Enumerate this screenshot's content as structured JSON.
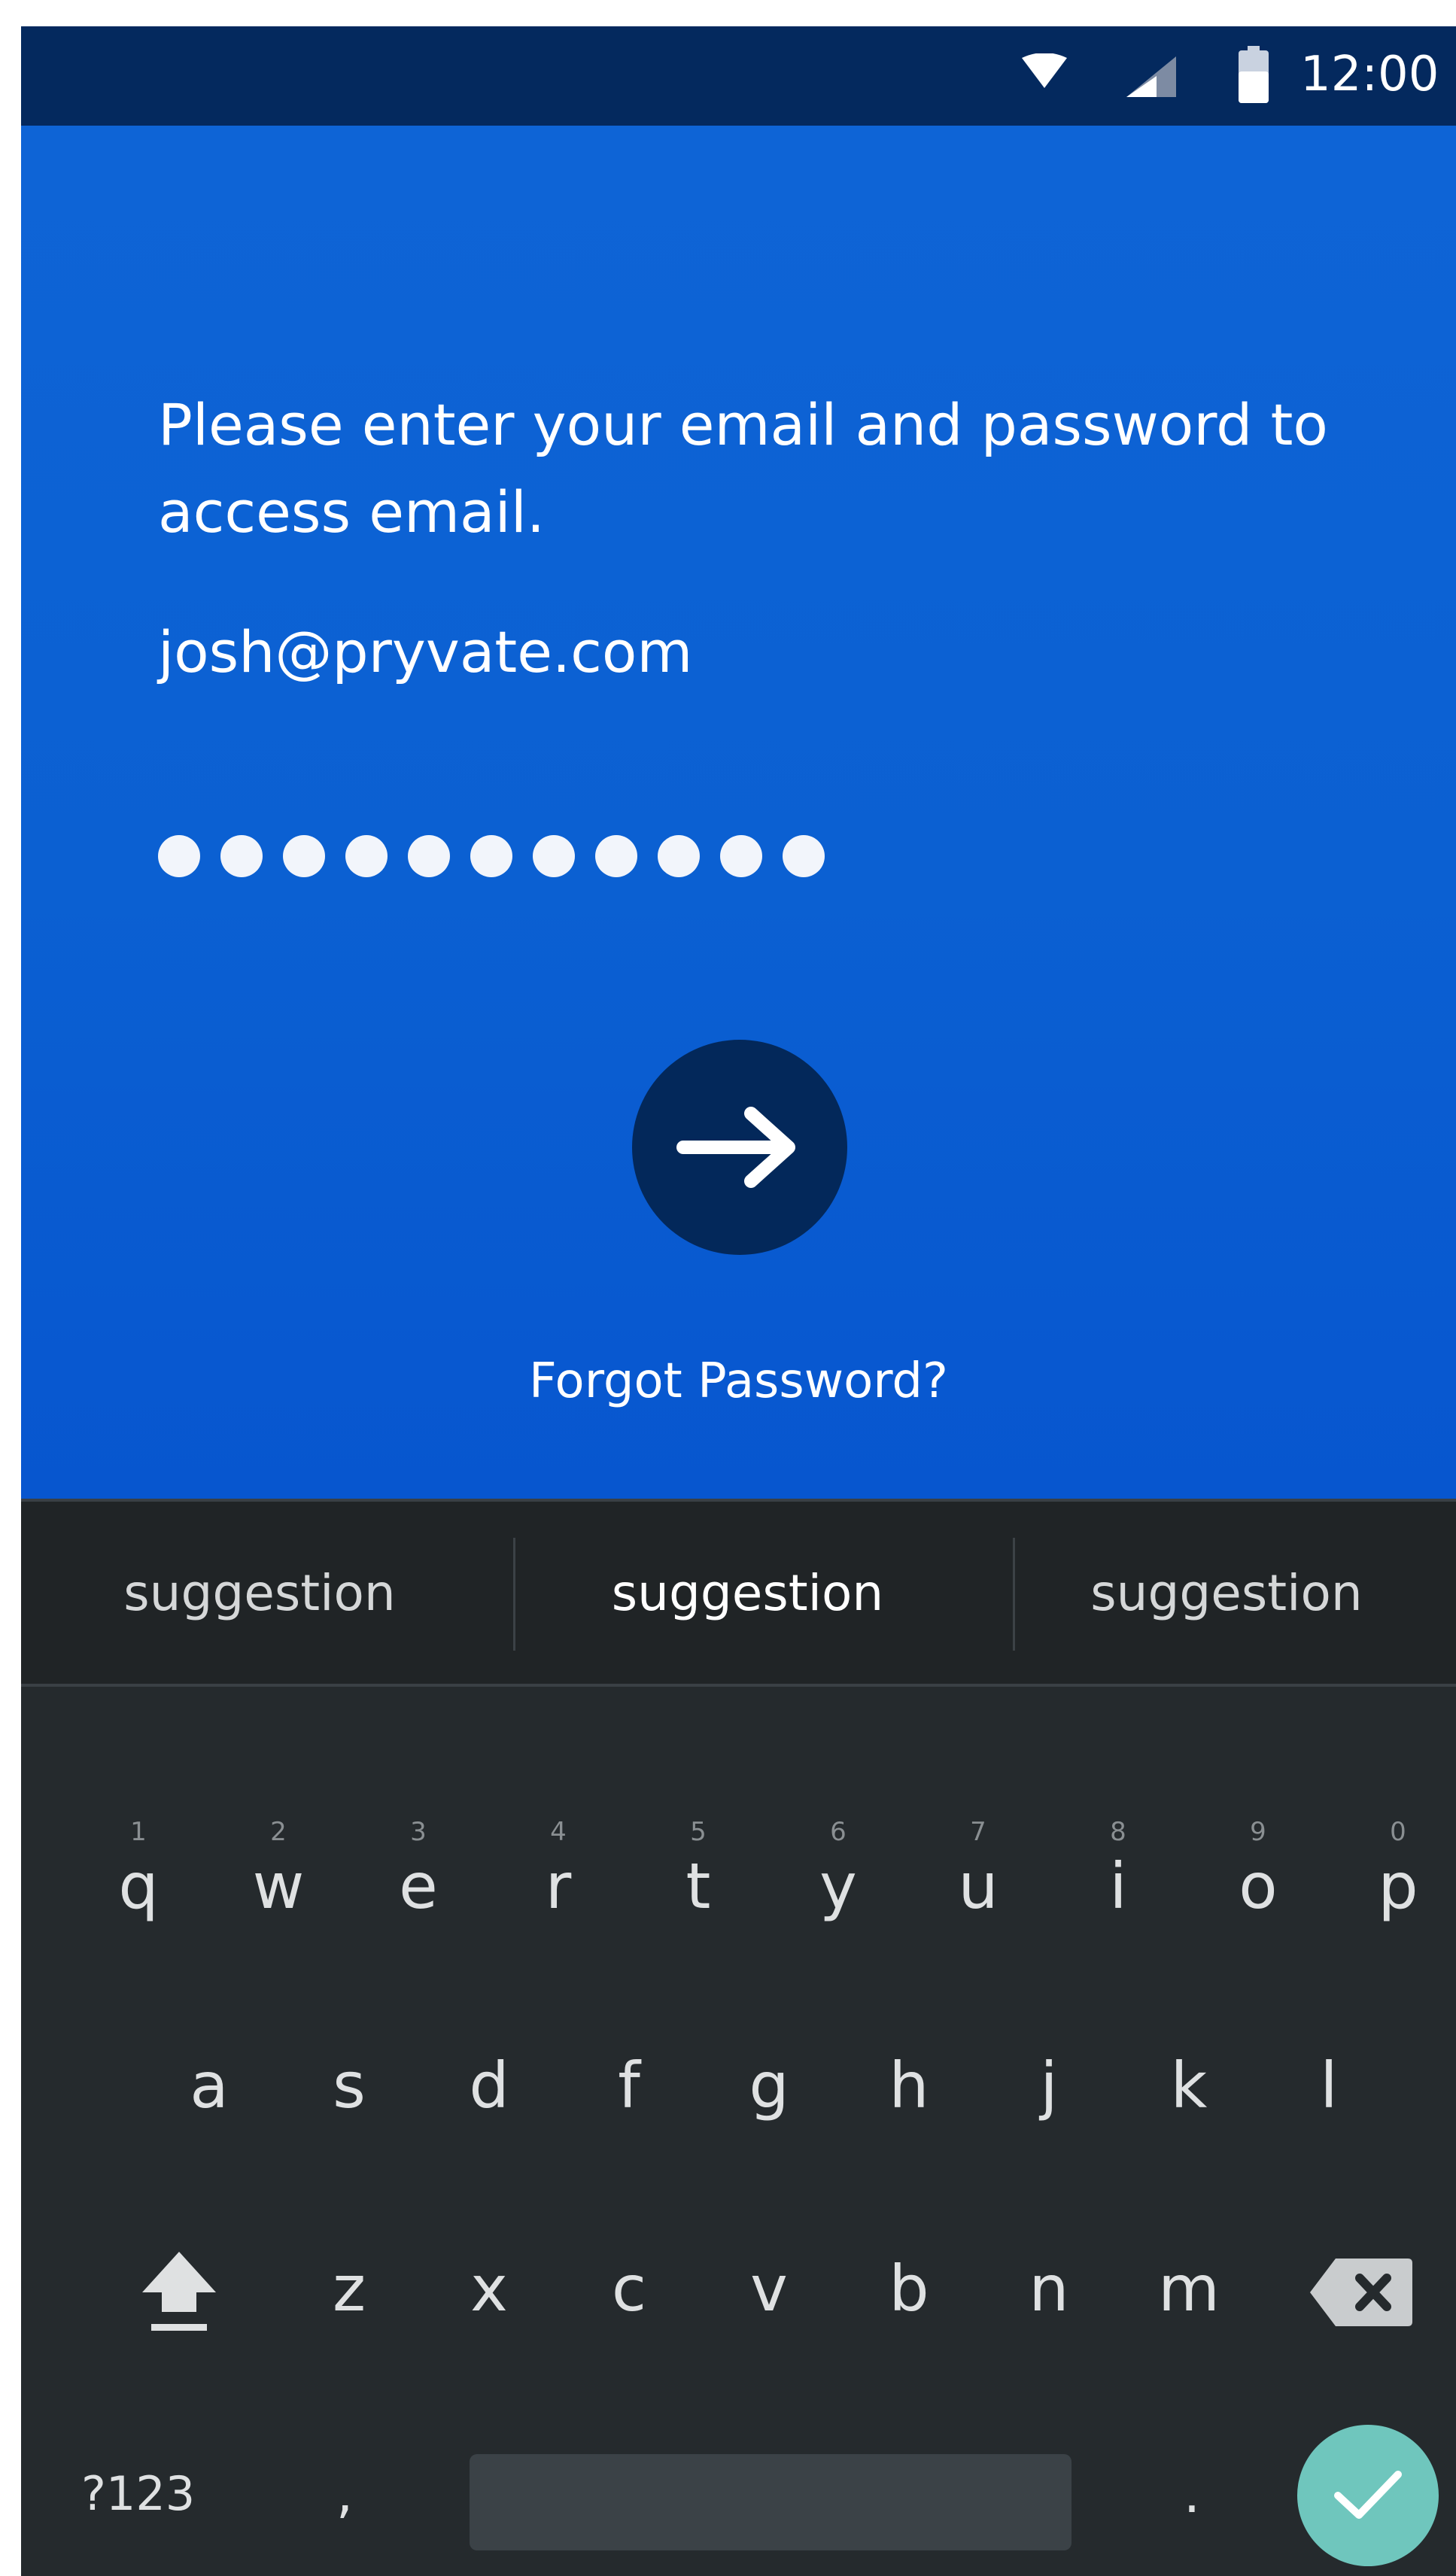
{
  "status_bar": {
    "time": "12:00",
    "icons": [
      "wifi-icon",
      "cell-signal-icon",
      "battery-icon"
    ]
  },
  "login": {
    "prompt": "Please enter your email and password to access email.",
    "email_value": "josh@pryvate.com",
    "password_mask_length": 11,
    "submit_icon": "arrow-right-icon",
    "forgot_password": "Forgot Password?"
  },
  "keyboard": {
    "suggestions": [
      "suggestion",
      "suggestion",
      "suggestion"
    ],
    "row1": [
      {
        "letter": "q",
        "hint": "1"
      },
      {
        "letter": "w",
        "hint": "2"
      },
      {
        "letter": "e",
        "hint": "3"
      },
      {
        "letter": "r",
        "hint": "4"
      },
      {
        "letter": "t",
        "hint": "5"
      },
      {
        "letter": "y",
        "hint": "6"
      },
      {
        "letter": "u",
        "hint": "7"
      },
      {
        "letter": "i",
        "hint": "8"
      },
      {
        "letter": "o",
        "hint": "9"
      },
      {
        "letter": "p",
        "hint": "0"
      }
    ],
    "row2": [
      "a",
      "s",
      "d",
      "f",
      "g",
      "h",
      "j",
      "k",
      "l"
    ],
    "row3": [
      "z",
      "x",
      "c",
      "v",
      "b",
      "n",
      "m"
    ],
    "symbols_label": "?123",
    "comma": ",",
    "period": ".",
    "icons": {
      "shift": "shift-icon",
      "backspace": "backspace-icon",
      "enter": "checkmark-icon"
    }
  },
  "colors": {
    "status_bar": "#04295e",
    "login_background": "#0b60d2",
    "submit_button": "#03285a",
    "keyboard_background": "#252a2d",
    "enter_button": "#6fc6bd"
  }
}
